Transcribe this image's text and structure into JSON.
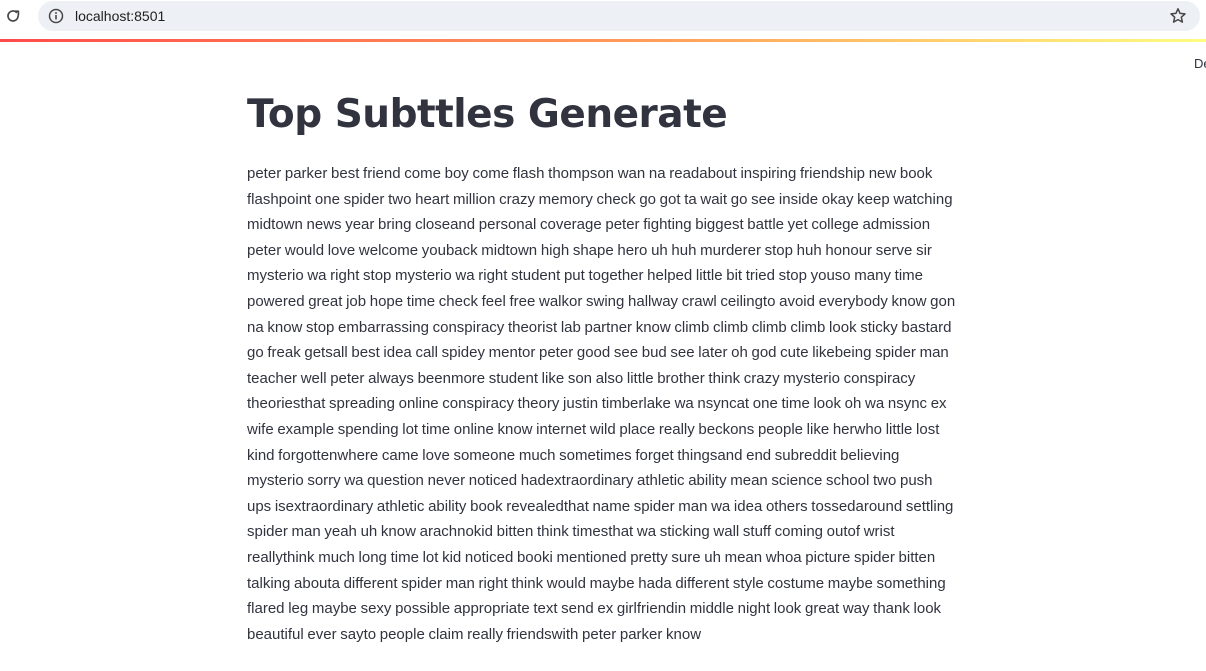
{
  "browser": {
    "url": "localhost:8501"
  },
  "header": {
    "deploy_label": "De"
  },
  "main": {
    "title": "Top Subttles Generate",
    "body": "peter parker best friend come boy come flash thompson wan na readabout inspiring friendship new book flashpoint one spider two heart million crazy memory check go got ta wait go see inside okay keep watching midtown news year bring closeand personal coverage peter fighting biggest battle yet college admission peter would love welcome youback midtown high shape hero uh huh murderer stop huh honour serve sir mysterio wa right stop mysterio wa right student put together helped little bit tried stop youso many time powered great job hope time check feel free walkor swing hallway crawl ceilingto avoid everybody know gon na know stop embarrassing conspiracy theorist lab partner know climb climb climb climb look sticky bastard go freak getsall best idea call spidey mentor peter good see bud see later oh god cute likebeing spider man teacher well peter always beenmore student like son also little brother think crazy mysterio conspiracy theoriesthat spreading online conspiracy theory justin timberlake wa nsyncat one time look oh wa nsync ex wife example spending lot time online know internet wild place really beckons people like herwho little lost kind forgottenwhere came love someone much sometimes forget thingsand end subreddit believing mysterio sorry wa question never noticed hadextraordinary athletic ability mean science school two push ups isextraordinary athletic ability book revealedthat name spider man wa idea others tossedaround settling spider man yeah uh know arachnokid bitten think timesthat wa sticking wall stuff coming outof wrist reallythink much long time lot kid noticed booki mentioned pretty sure uh mean whoa picture spider bitten talking abouta different spider man right think would maybe hada different style costume maybe something flared leg maybe sexy possible appropriate text send ex girlfriendin middle night look great way thank look beautiful ever sayto people claim really friendswith peter parker know"
  },
  "colors": {
    "text": "#31333f",
    "omnibox_bg": "#edf0f4",
    "accent_start": "#ff4b4b",
    "accent_end": "#fffd80"
  },
  "icons": [
    "reload-icon",
    "site-info-icon",
    "bookmark-star-icon"
  ]
}
